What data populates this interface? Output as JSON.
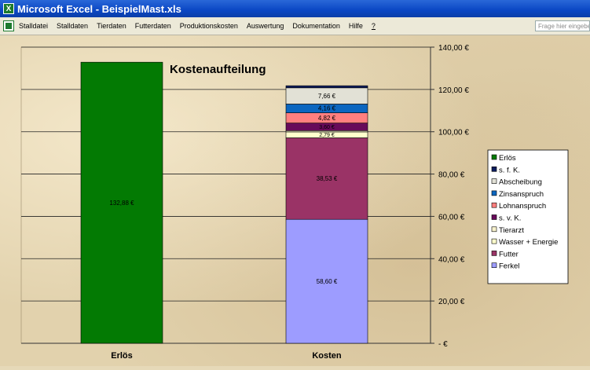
{
  "window": {
    "title": "Microsoft Excel - BeispielMast.xls"
  },
  "menu": {
    "items": [
      "Stalldatei",
      "Stalldaten",
      "Tierdaten",
      "Futterdaten",
      "Produktionskosten",
      "Auswertung",
      "Dokumentation",
      "Hilfe"
    ],
    "help_question": "?",
    "help_box_placeholder": "Frage hier eingeben"
  },
  "colors": {
    "titlebar": "#0a46c4",
    "erloes": "#037a03",
    "sfk": "#0e1d5e",
    "abscheibung": "#e2e1d6",
    "zinsanspruch": "#0b66c0",
    "lohnanspruch": "#ff7f7f",
    "svk": "#680a5a",
    "tierarzt": "#f8f2cc",
    "wasser": "#ffffcc",
    "futter": "#9a3366",
    "ferkel": "#9d9cff"
  },
  "chart_data": {
    "type": "bar",
    "stacked": true,
    "title": "Kostenaufteilung",
    "categories": [
      "Erlös",
      "Kosten"
    ],
    "y_axis": {
      "position": "right",
      "range": [
        0,
        140
      ],
      "ticks": [
        0,
        20,
        40,
        60,
        80,
        100,
        120,
        140
      ],
      "tick_labels": [
        "-   €",
        "20,00 €",
        "40,00 €",
        "60,00 €",
        "80,00 €",
        "100,00 €",
        "120,00 €",
        "140,00 €"
      ]
    },
    "grid": true,
    "legend_position": "right",
    "series": [
      {
        "name": "Erlös",
        "values": [
          132.88,
          0
        ],
        "color": "#037a03",
        "labels": [
          "132,88 €",
          ""
        ]
      },
      {
        "name": "Ferkel",
        "values": [
          0,
          58.6
        ],
        "color": "#9d9cff",
        "labels": [
          "",
          "58,60 €"
        ]
      },
      {
        "name": "Futter",
        "values": [
          0,
          38.53
        ],
        "color": "#9a3366",
        "labels": [
          "",
          "38,53 €"
        ]
      },
      {
        "name": "Wasser + Energie",
        "values": [
          0,
          2.79
        ],
        "color": "#ffffcc",
        "labels": [
          "",
          "2,79 €"
        ]
      },
      {
        "name": "Tierarzt",
        "values": [
          0,
          0.6
        ],
        "color": "#f8f2cc",
        "labels": [
          "",
          ""
        ]
      },
      {
        "name": "s. v. K.",
        "values": [
          0,
          3.6
        ],
        "color": "#680a5a",
        "labels": [
          "",
          "3,60 €"
        ]
      },
      {
        "name": "Lohnanspruch",
        "values": [
          0,
          4.82
        ],
        "color": "#ff7f7f",
        "labels": [
          "",
          "4,82 €"
        ]
      },
      {
        "name": "Zinsanspruch",
        "values": [
          0,
          4.16
        ],
        "color": "#0b66c0",
        "labels": [
          "",
          "4,16 €"
        ]
      },
      {
        "name": "Abscheibung",
        "values": [
          0,
          7.66
        ],
        "color": "#e2e1d6",
        "labels": [
          "",
          "7,66 €"
        ]
      },
      {
        "name": "s. f. K.",
        "values": [
          0,
          1.0
        ],
        "color": "#0e1d5e",
        "labels": [
          "",
          ""
        ]
      }
    ],
    "legend_order": [
      "Erlös",
      "s. f. K.",
      "Abscheibung",
      "Zinsanspruch",
      "Lohnanspruch",
      "s. v. K.",
      "Tierarzt",
      "Wasser + Energie",
      "Futter",
      "Ferkel"
    ]
  }
}
